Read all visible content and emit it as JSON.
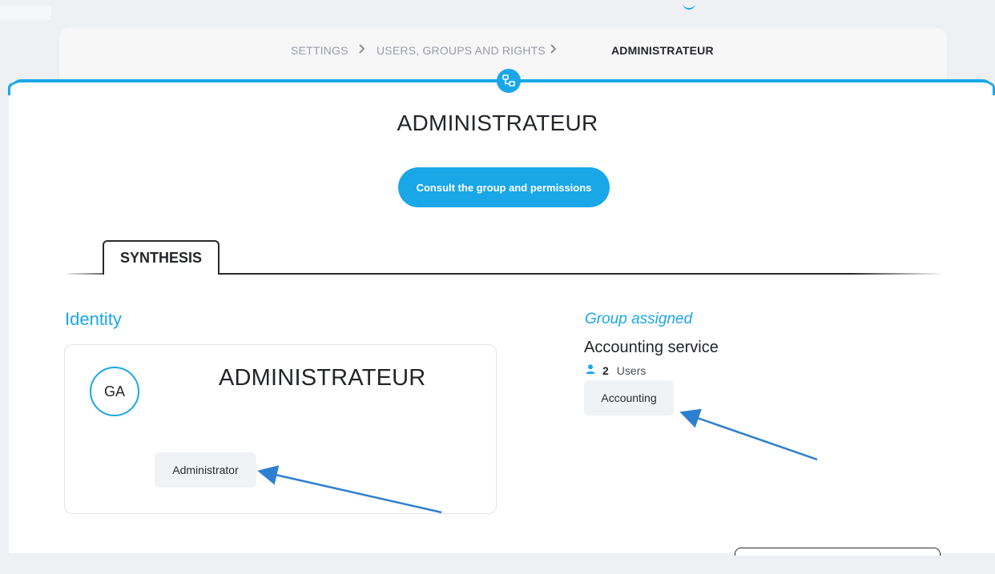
{
  "breadcrumb": {
    "items": [
      {
        "label": "SETTINGS"
      },
      {
        "label": "USERS, GROUPS AND RIGHTS"
      },
      {
        "label": "ADMINISTRATEUR"
      }
    ]
  },
  "page": {
    "title": "ADMINISTRATEUR",
    "consult_button": "Consult the group and permissions"
  },
  "tabs": [
    {
      "label": "SYNTHESIS",
      "active": true
    }
  ],
  "identity": {
    "heading": "Identity",
    "avatar_initials": "GA",
    "name": "ADMINISTRATEUR",
    "role_chip": "Administrator"
  },
  "group": {
    "heading": "Group assigned",
    "name": "Accounting service",
    "users_count": "2",
    "users_label": "Users",
    "chip": "Accounting"
  },
  "icons": {
    "breadcrumb_separator": "chevron-right-icon",
    "section_badge": "group-network-icon",
    "users": "user-icon"
  },
  "colors": {
    "accent": "#1aa7e8",
    "annotation_arrow": "#2f7fd0"
  }
}
